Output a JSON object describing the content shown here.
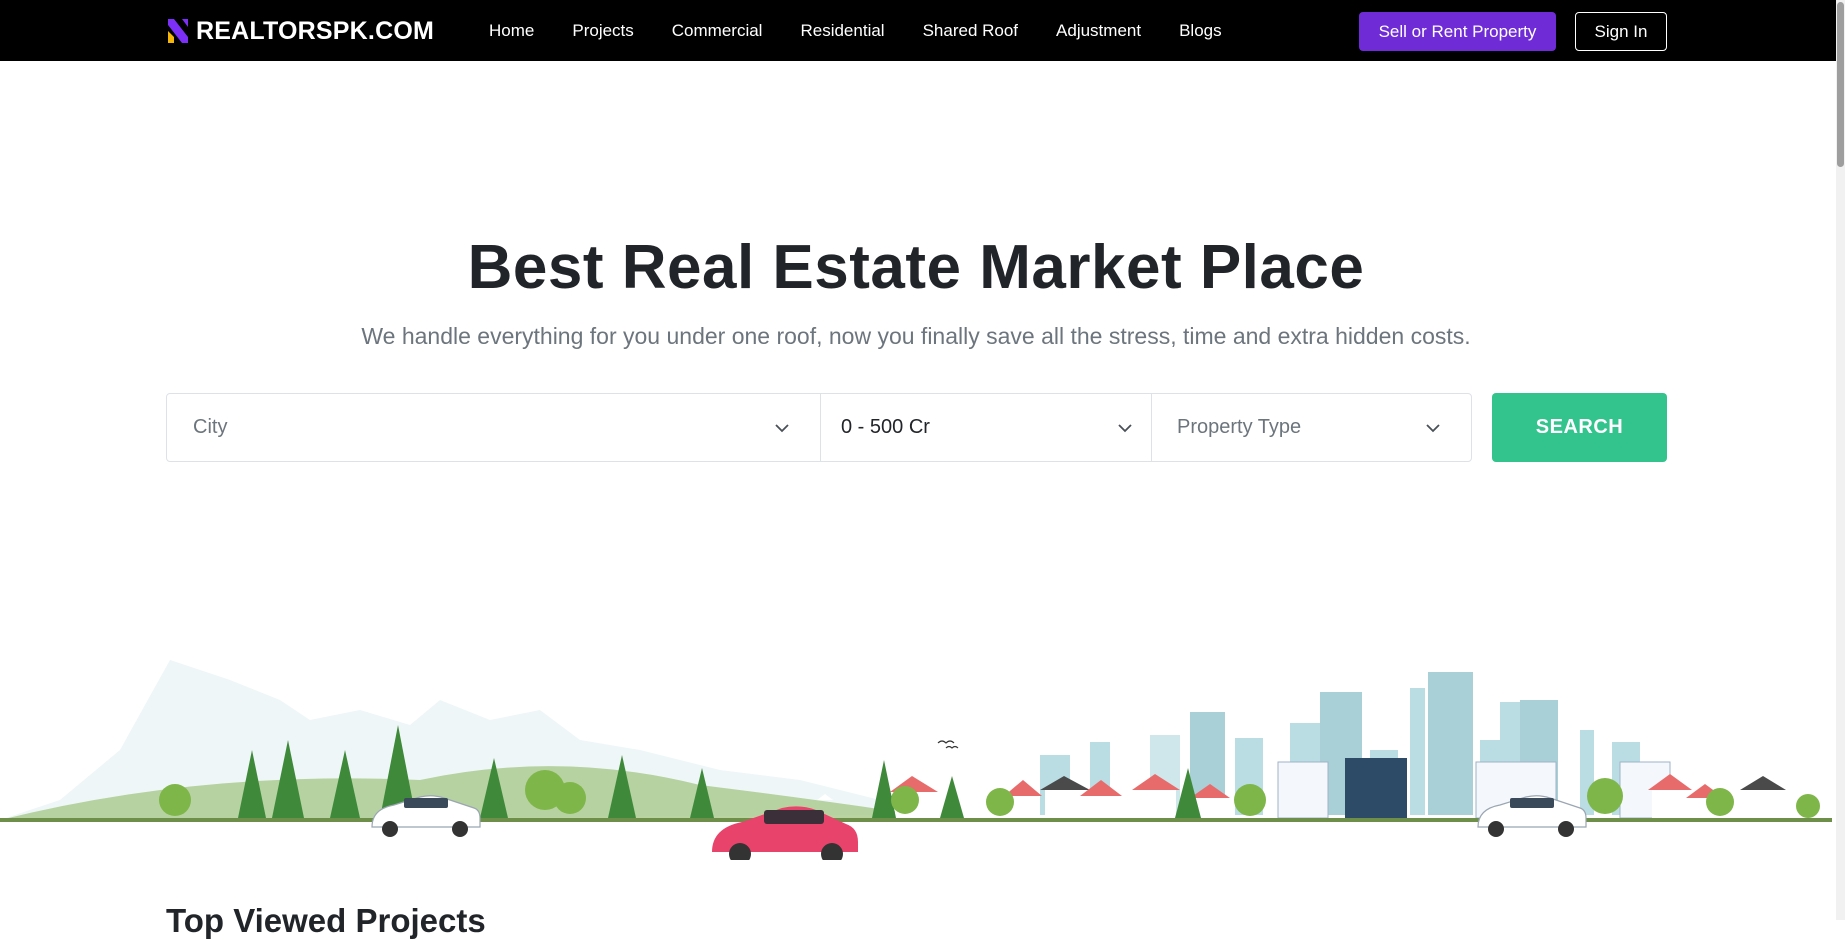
{
  "brand": {
    "name": "REALTORSPK.COM",
    "logo_icon": "realtorspk-logo-icon"
  },
  "nav": {
    "items": [
      {
        "label": "Home"
      },
      {
        "label": "Projects"
      },
      {
        "label": "Commercial"
      },
      {
        "label": "Residential"
      },
      {
        "label": "Shared Roof"
      },
      {
        "label": "Adjustment"
      },
      {
        "label": "Blogs"
      }
    ],
    "sell_label": "Sell or Rent Property",
    "signin_label": "Sign In"
  },
  "hero": {
    "title": "Best Real Estate Market Place",
    "subtitle": "We handle everything for you under one roof, now you finally save all the stress, time and extra hidden costs."
  },
  "search": {
    "city_placeholder": "City",
    "budget_value": "0 - 500 Cr",
    "type_placeholder": "Property Type",
    "button_label": "SEARCH"
  },
  "section": {
    "title": "Top Viewed Projects"
  },
  "colors": {
    "navbar_bg": "#000000",
    "accent_purple": "#6f2bd6",
    "search_green": "#33c48d",
    "car_red": "#e8436a"
  }
}
